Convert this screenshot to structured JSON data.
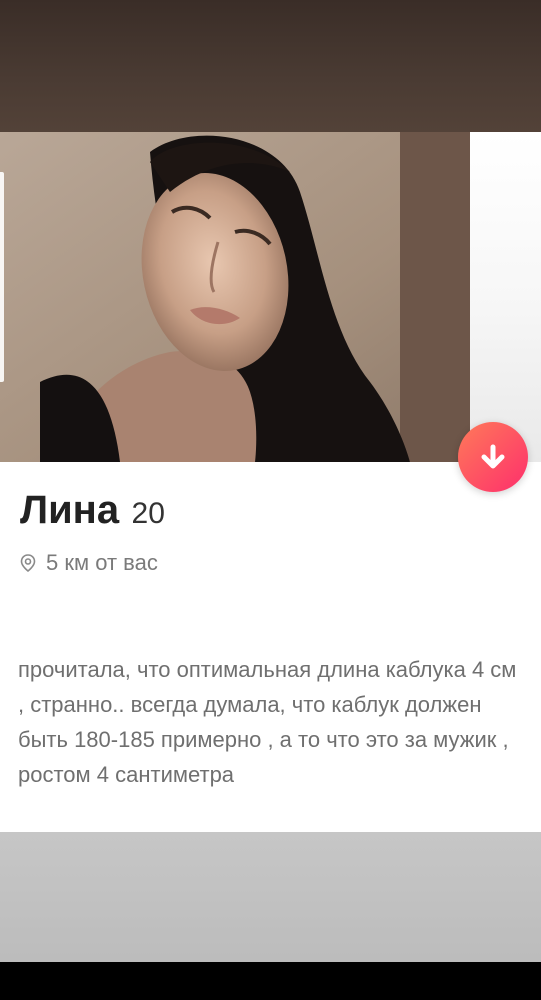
{
  "profile": {
    "name": "Лина",
    "age": "20",
    "distance": "5 км от вас",
    "bio": "прочитала, что оптимальная длина каблука 4 см , странно.. всегда думала, что каблук должен быть 180-185 примерно , а то что это за мужик , ростом 4 сантиметра"
  },
  "icons": {
    "down_button": "arrow-down-icon",
    "location": "location-pin-icon"
  },
  "colors": {
    "accent_start": "#ff7a59",
    "accent_end": "#fd2f6c",
    "name_text": "#222222",
    "secondary_text": "#7a7a7a"
  }
}
